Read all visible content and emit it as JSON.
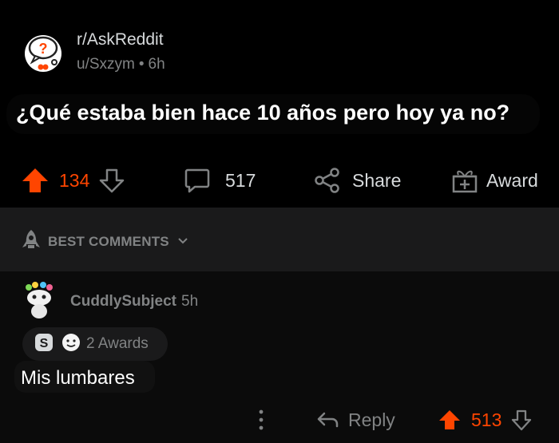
{
  "post": {
    "subreddit": "r/AskReddit",
    "user": "u/Sxzym",
    "separator": "•",
    "age": "6h",
    "title": "¿Qué estaba bien hace 10 años pero hoy ya no?"
  },
  "actions": {
    "upvotes": "134",
    "comments": "517",
    "share": "Share",
    "award": "Award"
  },
  "sort": {
    "label": "BEST COMMENTS"
  },
  "comment": {
    "user": "CuddlySubject",
    "age": "5h",
    "awards": "2 Awards",
    "body": "Mis lumbares",
    "reply": "Reply",
    "votes": "513"
  },
  "colors": {
    "accent": "#ff4500",
    "muted": "#818384",
    "background": "#000000"
  }
}
